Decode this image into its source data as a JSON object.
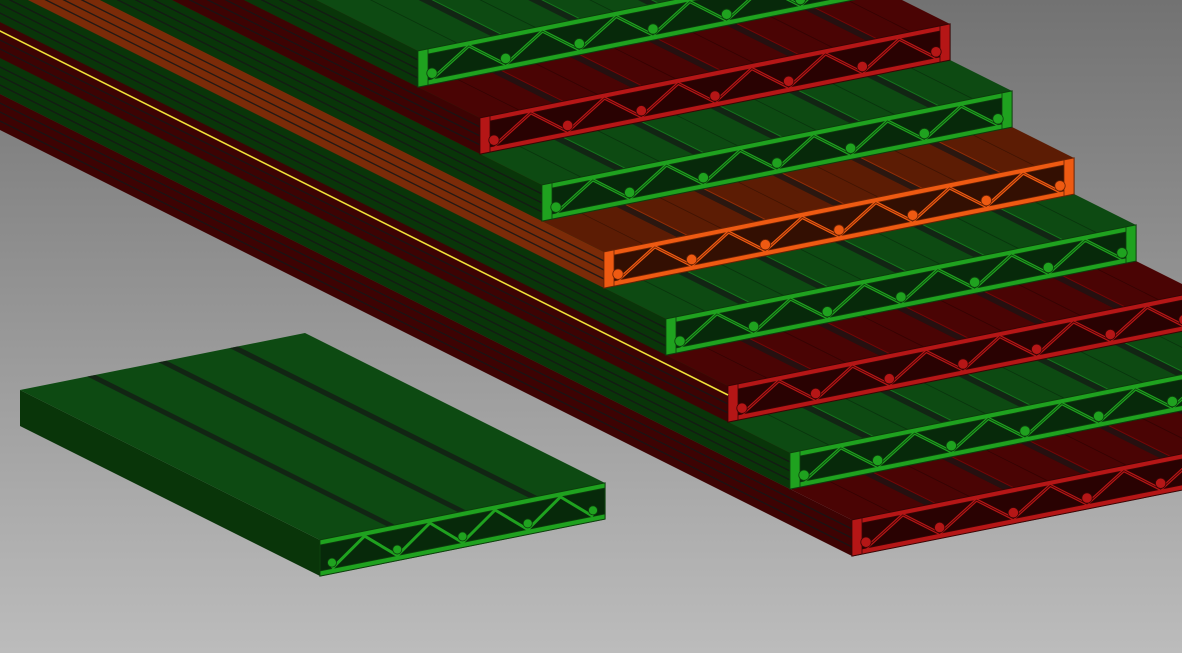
{
  "viewport": {
    "background_top": "#727272",
    "background_bottom": "#bcbcbc"
  },
  "colors": {
    "green_face": "#1fa21f",
    "green_edge": "#0d3f0d",
    "green_top": "#0d4a12",
    "green_side": "#093509",
    "red_face": "#b51616",
    "red_edge": "#3a0505",
    "red_top": "#4a0404",
    "red_side": "#3d0303",
    "orange_face": "#ee5a12",
    "orange_edge": "#6a2305",
    "orange_top": "#5c1c04",
    "orange_side": "#7b2b08",
    "selection_edge": "#f2e23a",
    "gap": "#161616"
  },
  "stack": {
    "profiles": [
      {
        "color": "green"
      },
      {
        "color": "red"
      },
      {
        "color": "green"
      },
      {
        "color": "orange"
      },
      {
        "color": "green"
      },
      {
        "color": "red"
      },
      {
        "color": "green"
      },
      {
        "color": "red"
      }
    ]
  },
  "loose_part": {
    "color": "green",
    "state": "detached"
  },
  "selection": {
    "state": "highlighted edge",
    "color": "#f2e23a"
  }
}
